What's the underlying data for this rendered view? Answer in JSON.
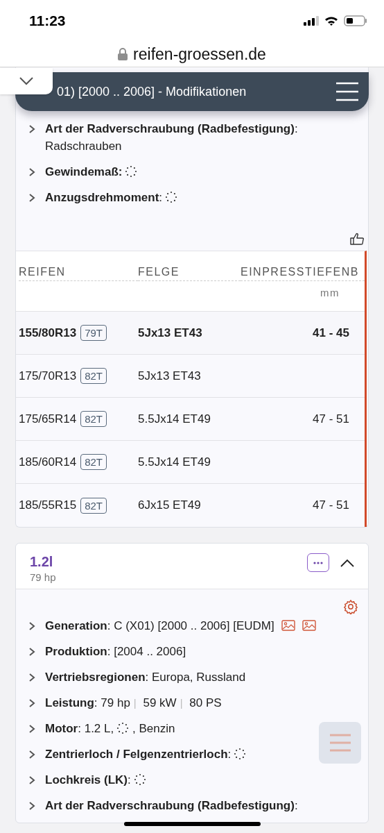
{
  "status_bar": {
    "time": "11:23"
  },
  "browser": {
    "url": "reifen-groessen.de"
  },
  "header": {
    "title": "01) [2000 .. 2006] - Modifikationen"
  },
  "top_card": {
    "specs": [
      {
        "label": "**Art der Radverschraubung (Radbefestigung)**:",
        "value": [
          {
            "kind": "text",
            "text": "Radschrauben"
          }
        ]
      },
      {
        "label": "**Gewindemaß:**",
        "value": [
          {
            "kind": "spinner"
          }
        ]
      },
      {
        "label": "**Anzugsdrehmoment**:",
        "value": [
          {
            "kind": "spinner"
          }
        ]
      }
    ],
    "table": {
      "columns": [
        {
          "label": "REIFEN"
        },
        {
          "label": "FELGE"
        },
        {
          "label": "EINPRESSTIEFENB",
          "unit": "mm"
        }
      ],
      "rows": [
        {
          "tire": "155/80R13",
          "load": "79T",
          "rim": "5Jx13 ET43",
          "offset": "41 - 45",
          "selected": true
        },
        {
          "tire": "175/70R13",
          "load": "82T",
          "rim": "5Jx13 ET43",
          "selected": false
        },
        {
          "tire": "175/65R14",
          "load": "82T",
          "rim": "5.5Jx14 ET49",
          "offset": "47 - 51",
          "selected": false
        },
        {
          "tire": "185/60R14",
          "load": "82T",
          "rim": "5.5Jx14 ET49",
          "selected": false
        },
        {
          "tire": "185/55R15",
          "load": "82T",
          "rim": "6Jx15 ET49",
          "offset": "47 - 51",
          "selected": false
        }
      ]
    }
  },
  "engine_card": {
    "title": "1.2l",
    "subtitle": "79 hp",
    "expanded": true,
    "specs": [
      {
        "label": "**Generation**:",
        "value": [
          {
            "kind": "text",
            "text": "C (X01) [2000 .. 2006] [EUDM]"
          },
          {
            "kind": "image"
          },
          {
            "kind": "image"
          }
        ]
      },
      {
        "label": "**Produktion**:",
        "value": [
          {
            "kind": "text",
            "text": "[2004 .. 2006]"
          }
        ]
      },
      {
        "label": "**Vertriebsregionen**:",
        "value": [
          {
            "kind": "text",
            "text": "Europa, Russland"
          }
        ]
      },
      {
        "label": "**Leistung**:",
        "value": [
          {
            "kind": "text",
            "text": "79 hp"
          },
          {
            "kind": "sep",
            "text": "|"
          },
          {
            "kind": "text",
            "text": "59 kW"
          },
          {
            "kind": "sep",
            "text": "|"
          },
          {
            "kind": "text",
            "text": "80 PS"
          }
        ]
      },
      {
        "label": "**Motor**:",
        "value": [
          {
            "kind": "text",
            "text": "1.2 L,"
          },
          {
            "kind": "spinner"
          },
          {
            "kind": "text",
            "text": ", Benzin"
          }
        ]
      },
      {
        "label": "**Zentrierloch / Felgenzentrierloch**:",
        "value": [
          {
            "kind": "spinner"
          }
        ]
      },
      {
        "label": "**Lochkreis (LK)**:",
        "value": [
          {
            "kind": "spinner"
          }
        ]
      },
      {
        "label": "**Art der Radverschraubung (Radbefestigung)**:"
      }
    ]
  }
}
